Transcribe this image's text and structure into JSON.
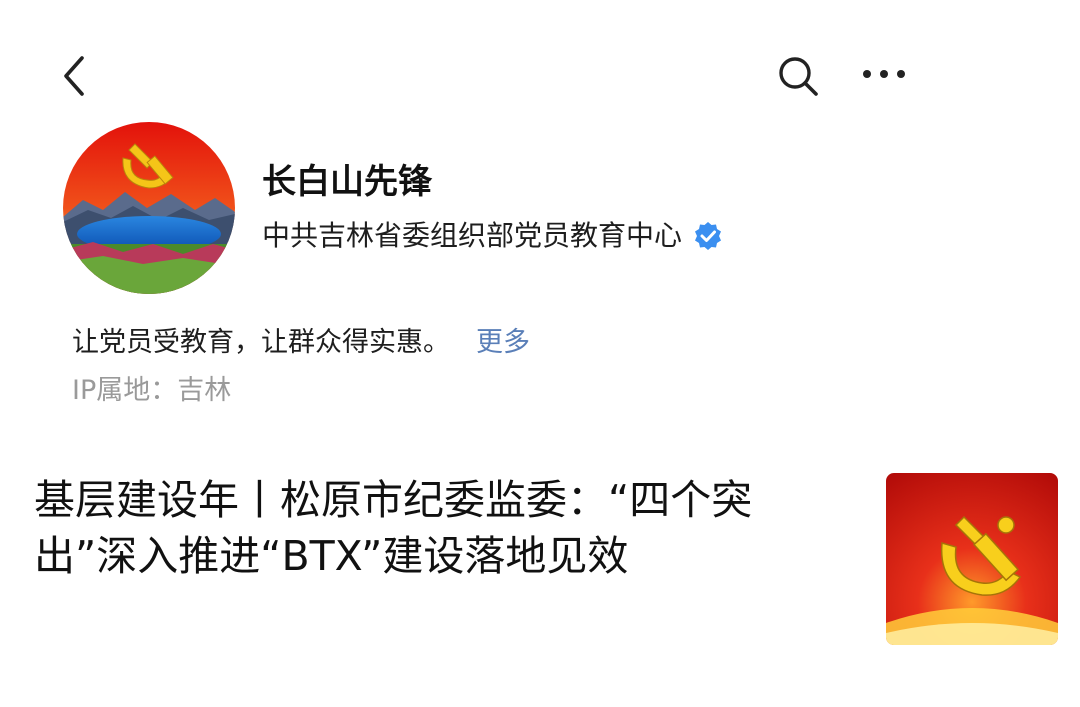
{
  "nav": {
    "back_icon": "chevron-left-icon",
    "search_icon": "search-icon",
    "more_icon": "more-horizontal-icon"
  },
  "profile": {
    "name": "长白山先锋",
    "organization": "中共吉林省委组织部党员教育中心",
    "verified_icon": "verified-badge-icon",
    "bio": "让党员受教育，让群众得实惠。",
    "more_label": "更多",
    "ip_location": "IP属地：吉林"
  },
  "article": {
    "title": "基层建设年丨松原市纪委监委：“四个突出”深入推进“BTX”建设落地见效"
  },
  "colors": {
    "accent_link": "#5a7fb8",
    "verified_blue": "#3b8ff0",
    "muted_text": "#9a9a9a",
    "party_red": "#d81e06",
    "party_gold": "#f5c518"
  }
}
